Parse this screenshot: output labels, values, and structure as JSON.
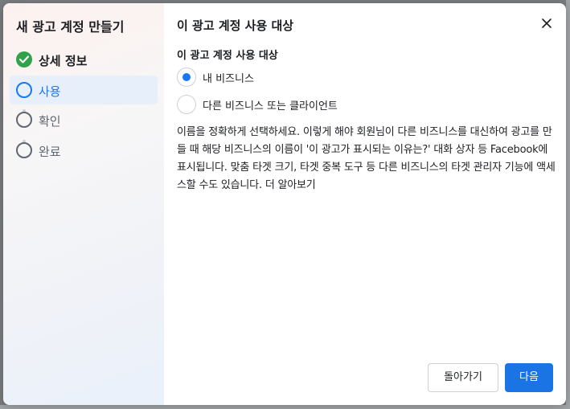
{
  "sidebar": {
    "title": "새 광고 계정 만들기",
    "steps": [
      {
        "label": "상세 정보",
        "state": "done"
      },
      {
        "label": "사용",
        "state": "current"
      },
      {
        "label": "확인",
        "state": "todo"
      },
      {
        "label": "완료",
        "state": "todo"
      }
    ]
  },
  "main": {
    "title": "이 광고 계정 사용 대상",
    "section_label": "이 광고 계정 사용 대상",
    "options": [
      {
        "label": "내 비즈니스",
        "selected": true
      },
      {
        "label": "다른 비즈니스 또는 클라이언트",
        "selected": false
      }
    ],
    "description": "이름을 정확하게 선택하세요. 이렇게 해야 회원님이 다른 비즈니스를 대신하여 광고를 만들 때 해당 비즈니스의 이름이 '이 광고가 표시되는 이유는?' 대화 상자 등 Facebook에 표시됩니다. 맞춤 타겟 크기, 타겟 중복 도구 등 다른 비즈니스의 타겟 관리자 기능에 액세스할 수도 있습니다.",
    "learn_more": "더 알아보기"
  },
  "footer": {
    "back_label": "돌아가기",
    "next_label": "다음"
  },
  "icons": {
    "close": "close-icon",
    "check": "checkmark-icon"
  },
  "colors": {
    "accent": "#1877f2",
    "done": "#31a24c",
    "primary_button": "#1b74e4"
  }
}
